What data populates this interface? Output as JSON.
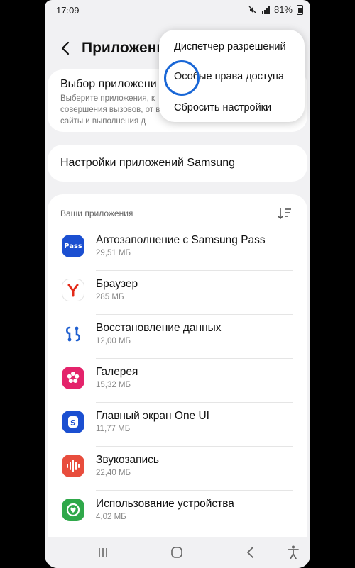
{
  "status": {
    "time": "17:09",
    "battery": "81%"
  },
  "header": {
    "title": "Приложения"
  },
  "card_choose": {
    "title": "Выбор приложени",
    "description": "Выберите приложения, к совершения вызовов, от веб-сайты и выполнения д"
  },
  "card_samsung": {
    "title": "Настройки приложений Samsung"
  },
  "apps_section": {
    "label": "Ваши приложения",
    "apps": [
      {
        "name": "Автозаполнение с Samsung Pass",
        "size": "29,51 МБ",
        "icon": "samsung-pass-icon"
      },
      {
        "name": "Браузер",
        "size": "285 МБ",
        "icon": "yandex-browser-icon"
      },
      {
        "name": "Восстановление данных",
        "size": "12,00 МБ",
        "icon": "data-restore-icon"
      },
      {
        "name": "Галерея",
        "size": "15,32 МБ",
        "icon": "gallery-icon"
      },
      {
        "name": "Главный экран One UI",
        "size": "11,77 МБ",
        "icon": "one-ui-home-icon"
      },
      {
        "name": "Звукозапись",
        "size": "22,40 МБ",
        "icon": "voice-recorder-icon"
      },
      {
        "name": "Использование устройства",
        "size": "4,02 МБ",
        "icon": "device-care-icon"
      }
    ]
  },
  "menu": {
    "items": [
      "Диспетчер разрешений",
      "Особые права доступа",
      "Сбросить настройки"
    ]
  },
  "colors": {
    "highlight": "#1866d6",
    "pass_blue": "#1b4fd1",
    "gallery_pink": "#e4236b",
    "recorder_red": "#e84d3d",
    "device_green": "#2fa84a"
  }
}
